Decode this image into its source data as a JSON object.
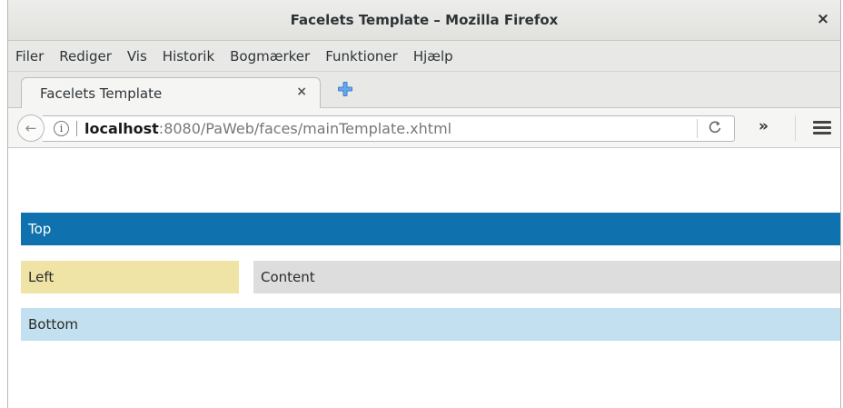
{
  "window": {
    "title": "Facelets Template – Mozilla Firefox",
    "close_glyph": "×"
  },
  "menubar": {
    "items": [
      "Filer",
      "Rediger",
      "Vis",
      "Historik",
      "Bogmærker",
      "Funktioner",
      "Hjælp"
    ]
  },
  "tabs": [
    {
      "label": "Facelets Template",
      "close_glyph": "×"
    }
  ],
  "new_tab_icon": "plus-icon",
  "navbar": {
    "back_glyph": "←",
    "info_glyph": "i",
    "url_host": "localhost",
    "url_rest": ":8080/PaWeb/faces/mainTemplate.xhtml",
    "reload_glyph": "C",
    "overflow_glyph": "»"
  },
  "page": {
    "top": "Top",
    "left": "Left",
    "content": "Content",
    "bottom": "Bottom"
  },
  "colors": {
    "top_bg": "#0f71ad",
    "left_bg": "#efe3a6",
    "content_bg": "#dddddd",
    "bottom_bg": "#c2e0ef",
    "new_tab_plus": "#3b7fd1"
  }
}
